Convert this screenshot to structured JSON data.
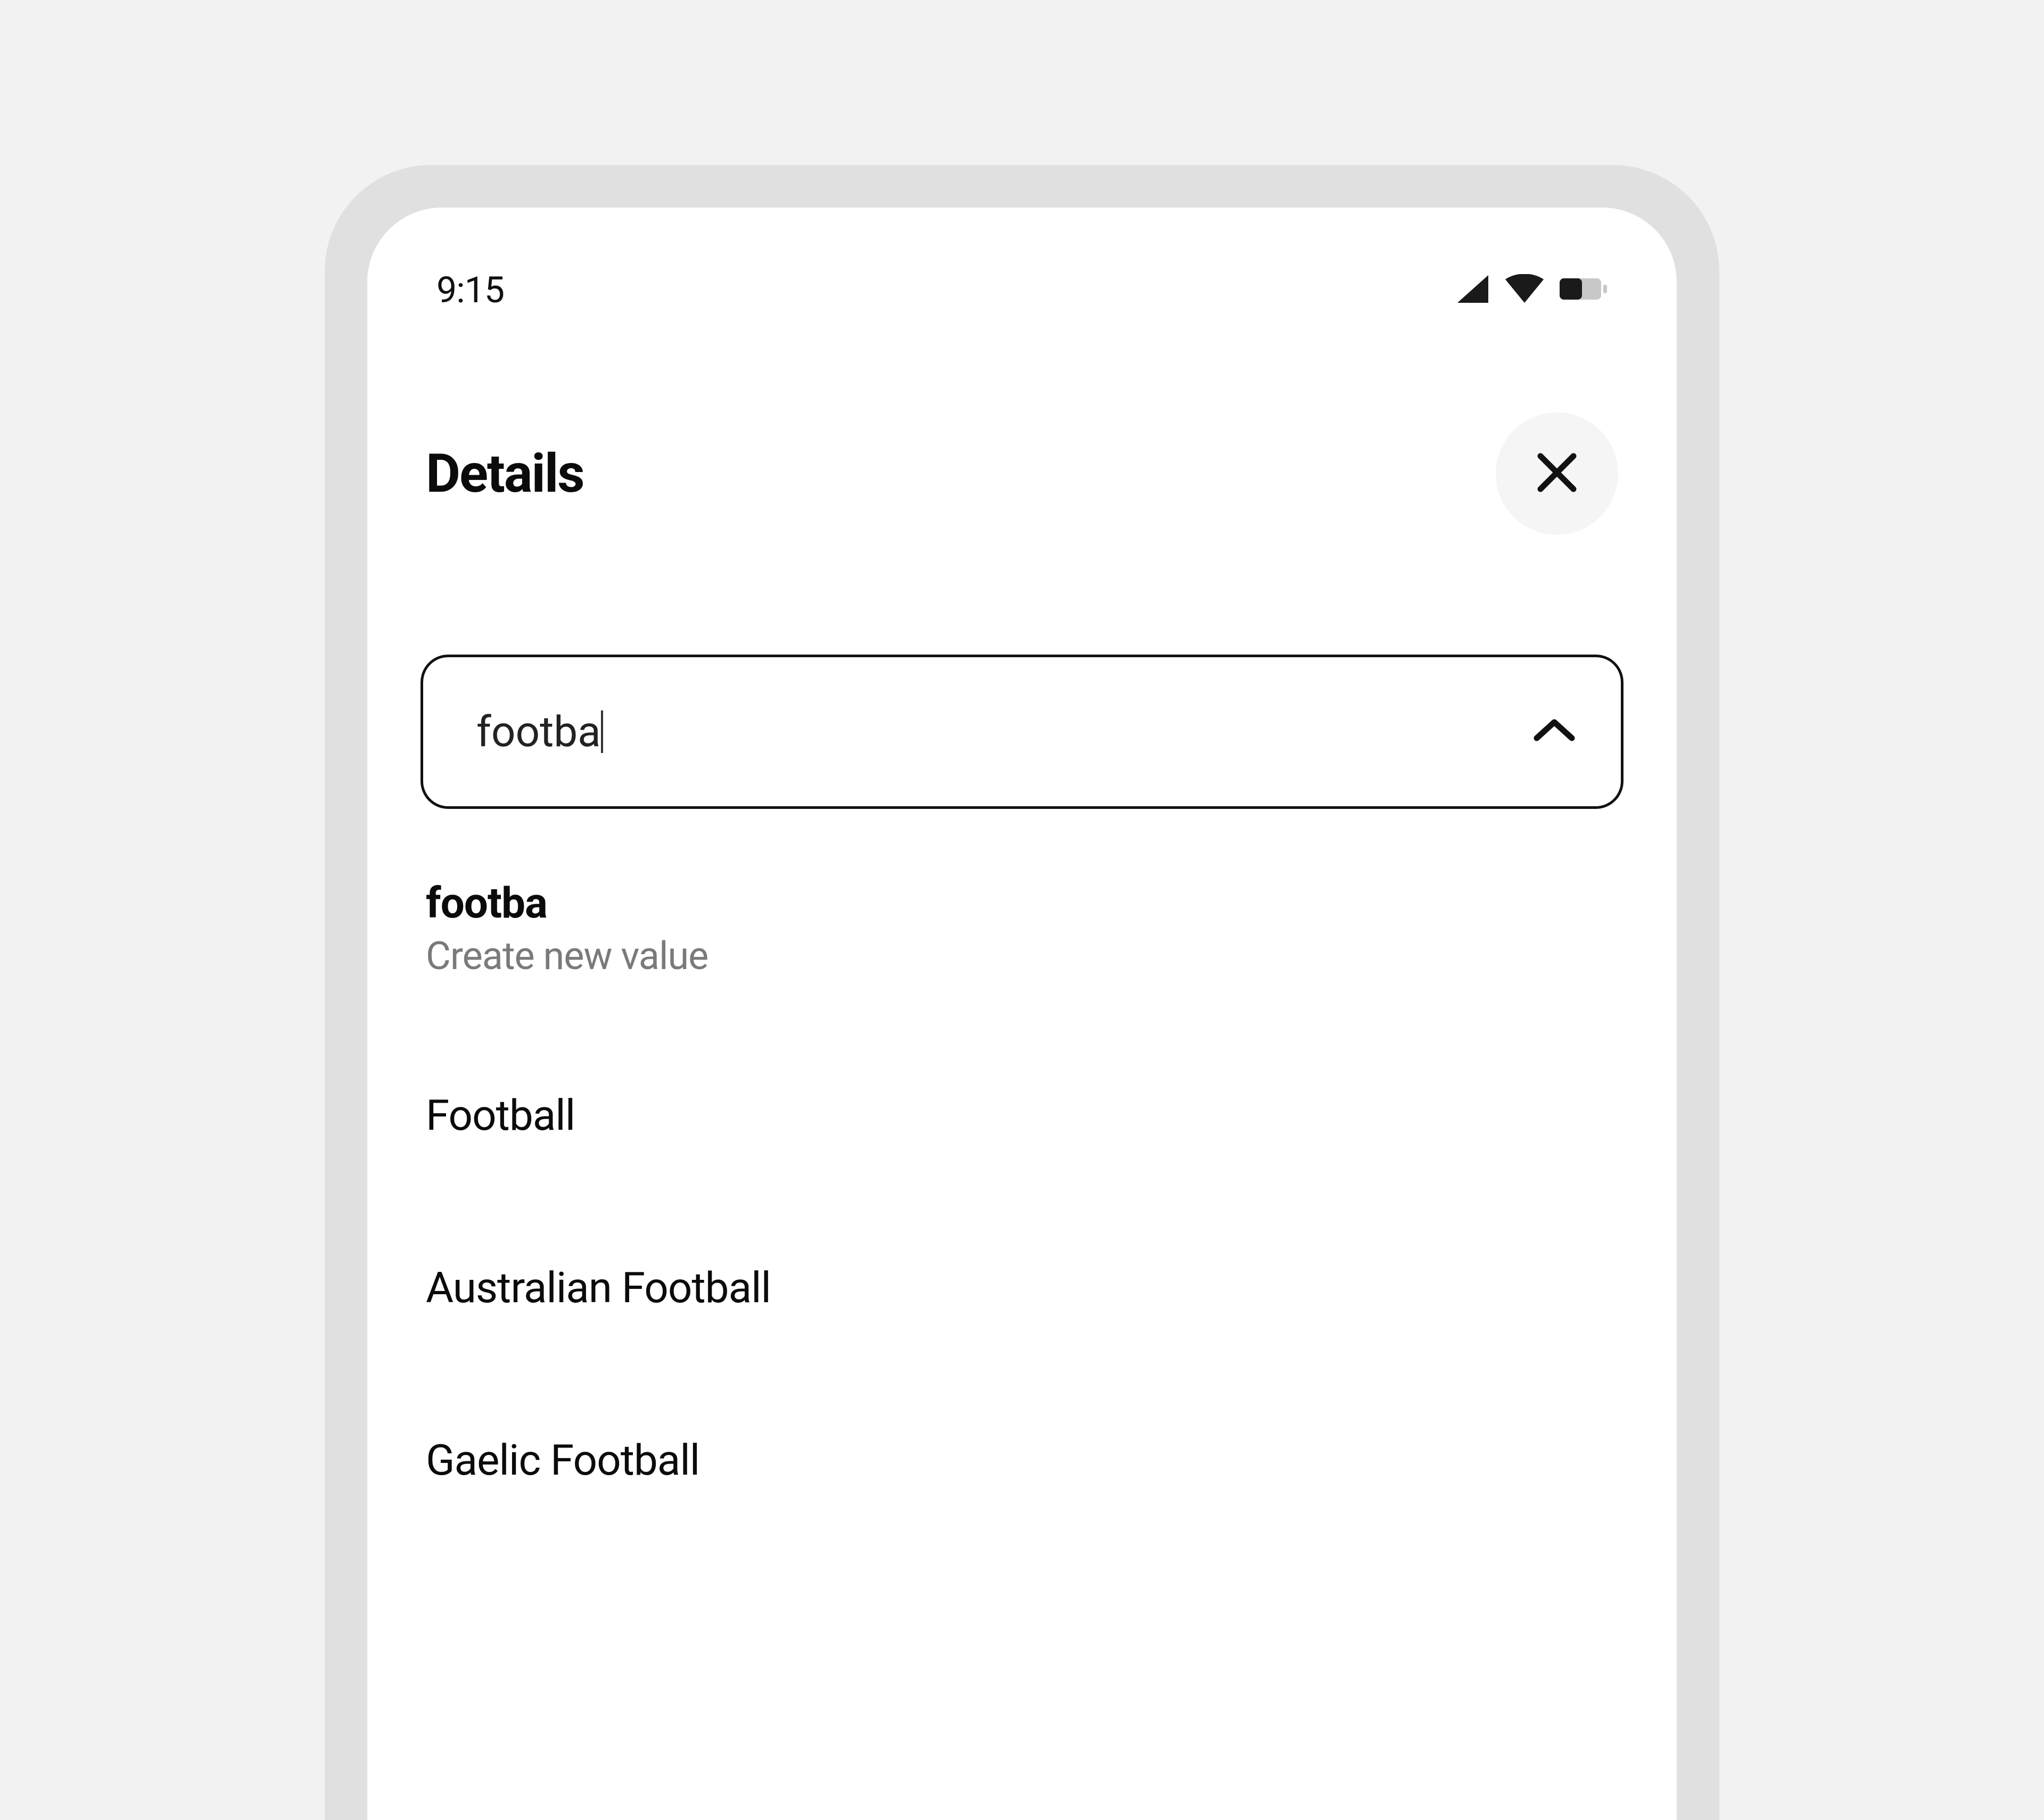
{
  "statusbar": {
    "time": "9:15"
  },
  "header": {
    "title": "Details"
  },
  "combo": {
    "value": "footba"
  },
  "create": {
    "title": "footba",
    "subtitle": "Create new value"
  },
  "options": [
    {
      "label": "Football"
    },
    {
      "label": "Australian Football"
    },
    {
      "label": "Gaelic Football"
    }
  ]
}
